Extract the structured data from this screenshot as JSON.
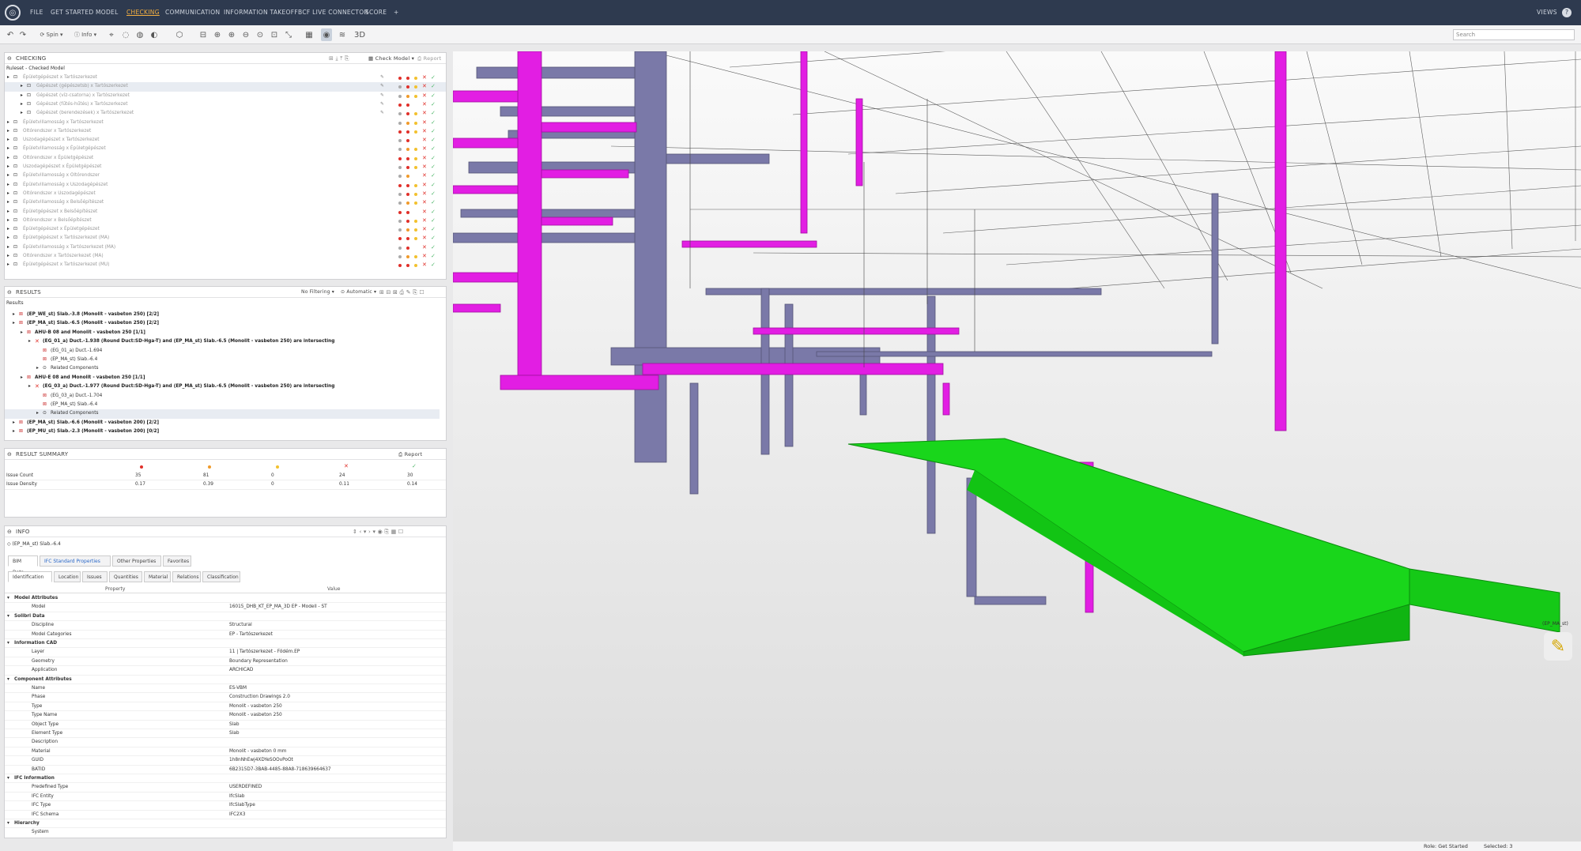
{
  "app": {
    "views_label": "VIEWS",
    "help": "?"
  },
  "menu": [
    "FILE",
    "GET STARTED",
    "MODEL",
    "CHECKING",
    "COMMUNICATION",
    "INFORMATION TAKEOFF",
    "BCF LIVE CONNECTOR",
    "SCORE",
    "+"
  ],
  "toolbar": {
    "spin": "Spin",
    "info": "Info",
    "search_placeholder": "Search"
  },
  "checking": {
    "title": "CHECKING",
    "check_model": "Check Model",
    "report": "Report",
    "tree_header": "Ruleset - Checked Model",
    "rows": [
      "Épületgépészet x Tartószerkezet",
      "Gépészet (gépészetsb) x Tartószerkezet",
      "Gépészet (víz-csatorna) x Tartószerkezet",
      "Gépészet (fűtés-hűtés) x Tartószerkezet",
      "Gépészet (berendezések) x Tartószerkezet",
      "Épületvillamosság x Tartószerkezet",
      "Oltórendszer x Tartószerkezet",
      "Uszodagépészet x Tartószerkezet",
      "Épületvillamosság x Épületgépészet",
      "Oltórendszer x Épületgépészet",
      "Uszodagépészet x Épületgépészet",
      "Épületvillamosság x Oltórendszer",
      "Épületvillamosság x Uszodagépészet",
      "Oltórendszer x Uszodagépészet",
      "Épületvillamosság x Belsőépítészet",
      "Épületgépészet x Belsőépítészet",
      "Oltórendszer x Belsőépítészet",
      "Épületgépészet x Épületgépészet",
      "Épületgépészet x Tartószerkezet (MA)",
      "Épületvillamosság x Tartószerkezet (MA)",
      "Oltórendszer x Tartószerkezet (MA)",
      "Épületgépészet x Tartószerkezet (MU)"
    ]
  },
  "results": {
    "title": "RESULTS",
    "filter": "No Filtering",
    "auto": "Automatic",
    "header": "Results",
    "rows": [
      "(EP_WE_st) Slab.-3.8 (Monolit - vasbeton 250) [2/2]",
      "(EP_MA_st) Slab.-6.5 (Monolit - vasbeton 250) [2/2]",
      "AHU-B 08 and Monolit - vasbeton 250 [1/1]",
      "(EG_01_a) Duct.-1.938 (Round Duct:SD-Hga-T) and (EP_MA_st) Slab.-6.5 (Monolit - vasbeton 250) are intersecting",
      "(EG_01_a) Duct.-1.694",
      "(EP_MA_st) Slab.-6.4",
      "Related Components",
      "AHU-E 08 and Monolit - vasbeton 250 [1/1]",
      "(EG_03_a) Duct.-1.977 (Round Duct:SD-Hga-T) and (EP_MA_st) Slab.-6.5 (Monolit - vasbeton 250) are intersecting",
      "(EG_03_a) Duct.-1.704",
      "(EP_MA_st) Slab.-6.4",
      "Related Components",
      "(EP_MA_st) Slab.-6.6 (Monolit - vasbeton 200) [2/2]",
      "(EP_MU_st) Slab.-2.3 (Monolit - vasbeton 200) [0/2]"
    ]
  },
  "summary": {
    "title": "RESULT SUMMARY",
    "report": "Report",
    "rows": [
      {
        "label": "Issue Count",
        "vals": [
          "35",
          "81",
          "0",
          "24",
          "30"
        ]
      },
      {
        "label": "Issue Density",
        "vals": [
          "0.17",
          "0.39",
          "0",
          "0.11",
          "0.14"
        ]
      }
    ]
  },
  "info": {
    "title": "INFO",
    "selected": "(EP_MA_st) Slab.-6.4",
    "tabs1": [
      "BIM Data",
      "IFC Standard Properties",
      "Other Properties",
      "Favorites"
    ],
    "tabs2": [
      "Identification",
      "Location",
      "Issues",
      "Quantities",
      "Material",
      "Relations",
      "Classification"
    ],
    "col_property": "Property",
    "col_value": "Value",
    "rows": [
      {
        "k": "Model Attributes",
        "cat": true
      },
      {
        "k": "Model",
        "v": "16015_DHB_KT_EP_MA_3D EP - Modell - ST"
      },
      {
        "k": "Solibri Data",
        "cat": true
      },
      {
        "k": "Discipline",
        "v": "Structural"
      },
      {
        "k": "Model Categories",
        "v": "EP - Tartószerkezet"
      },
      {
        "k": "Information CAD",
        "cat": true
      },
      {
        "k": "Layer",
        "v": "11 | Tartószerkezet - Födém.EP"
      },
      {
        "k": "Geometry",
        "v": "Boundary Representation"
      },
      {
        "k": "Application",
        "v": "ARCHICAD"
      },
      {
        "k": "Component Attributes",
        "cat": true
      },
      {
        "k": "Name",
        "v": "ES-VBM"
      },
      {
        "k": "Phase",
        "v": "Construction Drawings 2.0"
      },
      {
        "k": "Type",
        "v": "Monolit - vasbeton 250"
      },
      {
        "k": "Type Name",
        "v": "Monolit - vasbeton 250"
      },
      {
        "k": "Object Type",
        "v": "Slab"
      },
      {
        "k": "Element Type",
        "v": "Slab"
      },
      {
        "k": "Description",
        "v": ""
      },
      {
        "k": "Material",
        "v": "Monolit - vasbeton 0 mm"
      },
      {
        "k": "GUID",
        "v": "1h8nNhEwj4XDYeSOOvPoOt"
      },
      {
        "k": "BATID",
        "v": "6B2315D7-3BAB-4485-88A8-718639664637"
      },
      {
        "k": "IFC Information",
        "cat": true
      },
      {
        "k": "Predefined Type",
        "v": "USERDEFINED"
      },
      {
        "k": "IFC Entity",
        "v": "IfcSlab"
      },
      {
        "k": "IFC Type",
        "v": "IfcSlabType"
      },
      {
        "k": "IFC Schema",
        "v": "IFC2X3"
      },
      {
        "k": "Hierarchy",
        "cat": true
      },
      {
        "k": "System",
        "v": ""
      }
    ]
  },
  "viewport": {
    "title": "3D",
    "tag": "(EP_MA_st)"
  },
  "status": {
    "role": "Role: Get Started",
    "selected": "Selected: 3"
  },
  "colors": {
    "magenta": "#e21ee3",
    "duct": "#7a79a8",
    "slab": "#19d61b"
  }
}
